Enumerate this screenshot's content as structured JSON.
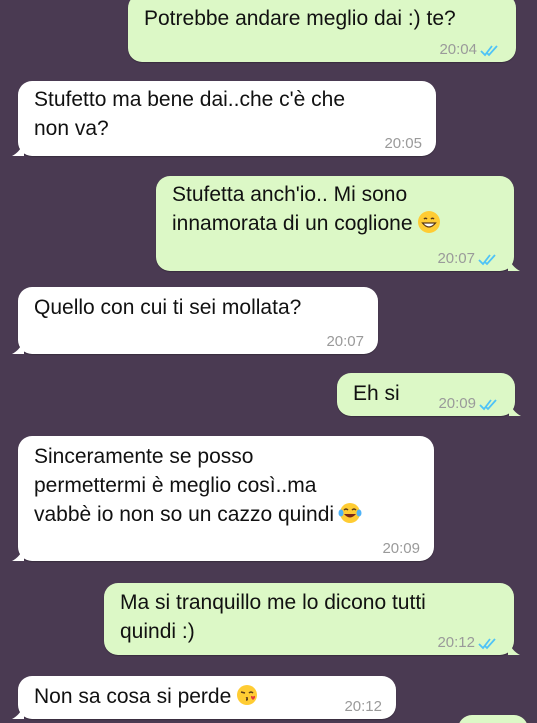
{
  "messages": [
    {
      "dir": "out",
      "text": "Potrebbe andare meglio dai :) te?",
      "time": "20:04",
      "ticks": true
    },
    {
      "dir": "in",
      "text": "Stufetto ma bene dai..che c'è che\nnon va?",
      "time": "20:05"
    },
    {
      "dir": "out",
      "text": "Stufetta anch'io.. Mi sono\ninnamorata di un coglione",
      "emoji": "grin-emoji",
      "time": "20:07",
      "ticks": true
    },
    {
      "dir": "in",
      "text": "Quello con cui ti sei mollata?",
      "time": "20:07"
    },
    {
      "dir": "out",
      "text": "Eh si",
      "time": "20:09",
      "ticks": true
    },
    {
      "dir": "in",
      "text": "Sinceramente se posso\npermettermi è meglio così..ma\nvabbè io non so un cazzo quindi",
      "emoji": "tears-of-joy-emoji",
      "time": "20:09"
    },
    {
      "dir": "out",
      "text": "Ma si tranquillo me lo dicono tutti\nquindi :)",
      "time": "20:12",
      "ticks": true
    },
    {
      "dir": "in",
      "text": "Non sa cosa si perde",
      "emoji": "kiss-emoji",
      "time": "20:12"
    }
  ],
  "colors": {
    "background": "#4a3a52",
    "outgoing": "#dcf8c6",
    "incoming": "#ffffff",
    "read_ticks": "#4fc3f7"
  }
}
